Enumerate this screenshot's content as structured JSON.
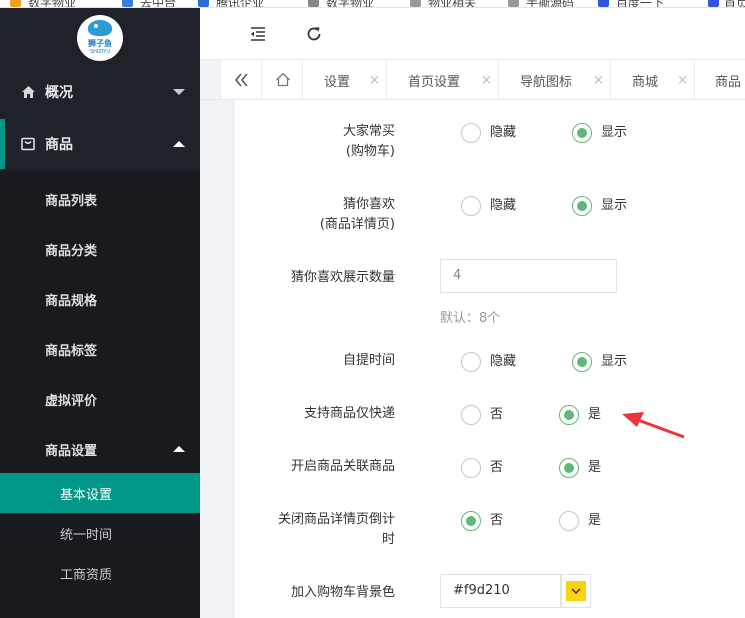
{
  "bookmarks": [
    "数字物业",
    "去中台",
    "腾讯企业",
    "数字物业",
    "物业相关",
    "手撕源码",
    "百度一下",
    "首页"
  ],
  "sidebar": {
    "logo_text": "狮子鱼",
    "logo_sub": "SHIZIYU",
    "overview_label": "概况",
    "goods_label": "商品",
    "sub_items": [
      "商品列表",
      "商品分类",
      "商品规格",
      "商品标签",
      "虚拟评价"
    ],
    "settings_label": "商品设置",
    "settings_items": [
      "基本设置",
      "统一时间",
      "工商资质"
    ]
  },
  "tabs": [
    {
      "label": "设置"
    },
    {
      "label": "首页设置"
    },
    {
      "label": "导航图标"
    },
    {
      "label": "商城"
    },
    {
      "label": "商品"
    }
  ],
  "tab_close_glyph": "×",
  "form": {
    "rows": [
      {
        "label_line1": "大家常买",
        "label_line2": "(购物车)",
        "opt1": "隐藏",
        "opt2": "显示",
        "selected": 2
      },
      {
        "label_line1": "猜你喜欢",
        "label_line2": "(商品详情页)",
        "opt1": "隐藏",
        "opt2": "显示",
        "selected": 2
      },
      {
        "label_line1": "自提时间",
        "opt1": "隐藏",
        "opt2": "显示",
        "selected": 2
      },
      {
        "label_line1": "支持商品仅快递",
        "opt1": "否",
        "opt2": "是",
        "selected": 2
      },
      {
        "label_line1": "开启商品关联商品",
        "opt1": "否",
        "opt2": "是",
        "selected": 2
      },
      {
        "label_line1": "关闭商品详情页倒计",
        "label_line2": "时",
        "opt1": "否",
        "opt2": "是",
        "selected": 1
      }
    ],
    "guess_count": {
      "label": "猜你喜欢展示数量",
      "value": "4",
      "hint": "默认：8个"
    },
    "cart_bg": {
      "label": "加入购物车背景色",
      "value": "#f9d210",
      "swatch_color": "#f9d210"
    }
  },
  "colors": {
    "accent": "#009688",
    "radio_green": "#5fb878",
    "sidebar_bg": "#20222a",
    "annotation_red": "#e8343a"
  }
}
